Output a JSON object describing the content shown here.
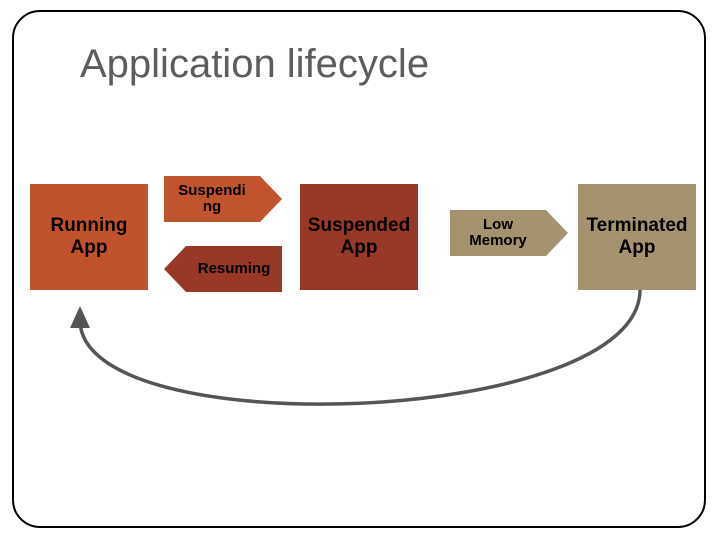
{
  "title": "Application lifecycle",
  "boxes": {
    "running": "Running\nApp",
    "suspended": "Suspended\nApp",
    "terminated": "Terminated\nApp"
  },
  "arrows": {
    "suspending": "Suspendi\nng",
    "resuming": "Resuming",
    "lowmemory": "Low\nMemory"
  },
  "chart_data": {
    "type": "diagram",
    "title": "Application lifecycle",
    "nodes": [
      {
        "id": "running",
        "label": "Running App",
        "color": "#c0532c"
      },
      {
        "id": "suspended",
        "label": "Suspended App",
        "color": "#983826"
      },
      {
        "id": "terminated",
        "label": "Terminated App",
        "color": "#a5926f"
      }
    ],
    "edges": [
      {
        "from": "running",
        "to": "suspended",
        "label": "Suspending",
        "color": "#c1542d"
      },
      {
        "from": "suspended",
        "to": "running",
        "label": "Resuming",
        "color": "#983826"
      },
      {
        "from": "suspended",
        "to": "terminated",
        "label": "Low Memory",
        "color": "#a5926f"
      },
      {
        "from": "terminated",
        "to": "running",
        "label": "",
        "style": "curved-return"
      }
    ]
  }
}
